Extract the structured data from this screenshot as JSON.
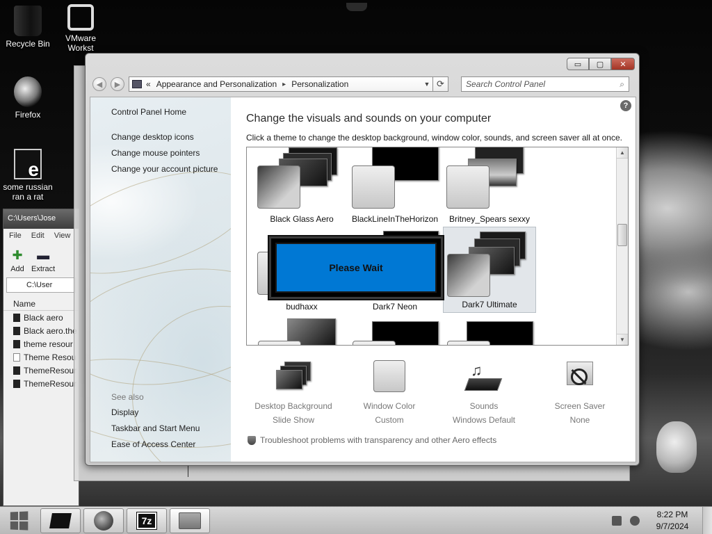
{
  "desktop": {
    "icons": [
      {
        "label": "Recycle Bin",
        "icon": "recycle-bin-icon"
      },
      {
        "label": "VMware Workst",
        "icon": "vmware-icon"
      },
      {
        "label": "Firefox",
        "icon": "firefox-icon"
      },
      {
        "label": "some russian ran a rat",
        "icon": "file-icon"
      }
    ]
  },
  "bg_window": {
    "title": "C:\\Users\\Jose",
    "menu": [
      "File",
      "Edit",
      "View"
    ],
    "tools": [
      {
        "label": "Add",
        "icon": "plus-icon"
      },
      {
        "label": "Extract",
        "icon": "minus-icon"
      }
    ],
    "address": "C:\\User",
    "column": "Name",
    "files": [
      "Black aero",
      "Black aero.the",
      "theme resour",
      "Theme Resou",
      "ThemeResour",
      "ThemeResour"
    ]
  },
  "window": {
    "caption": {
      "minimize": "▭",
      "maximize": "▢",
      "close": "✕"
    },
    "breadcrumb": {
      "root_chevron": "«",
      "level1": "Appearance and Personalization",
      "separator": "▸",
      "level2": "Personalization"
    },
    "search_placeholder": "Search Control Panel"
  },
  "left_pane": {
    "home": "Control Panel Home",
    "links": [
      "Change desktop icons",
      "Change mouse pointers",
      "Change your account picture"
    ],
    "see_also_title": "See also",
    "see_also": [
      "Display",
      "Taskbar and Start Menu",
      "Ease of Access Center"
    ]
  },
  "main": {
    "title": "Change the visuals and sounds on your computer",
    "subtitle": "Click a theme to change the desktop background, window color, sounds, and screen saver all at once.",
    "themes": [
      {
        "label": "Black Glass Aero",
        "selected": false
      },
      {
        "label": "BlackLineInTheHorizon",
        "selected": false
      },
      {
        "label": "Britney_Spears sexxy",
        "selected": false
      },
      {
        "label": "budhaxx",
        "selected": false
      },
      {
        "label": "Dark7 Neon",
        "selected": false
      },
      {
        "label": "Dark7 Ultimate",
        "selected": true
      }
    ],
    "overlay": "Please Wait",
    "overlay_color": "#0078d4",
    "tools": [
      {
        "title": "Desktop Background",
        "value": "Slide Show",
        "icon": "desktop-background-icon"
      },
      {
        "title": "Window Color",
        "value": "Custom",
        "icon": "window-color-icon"
      },
      {
        "title": "Sounds",
        "value": "Windows Default",
        "icon": "sounds-icon"
      },
      {
        "title": "Screen Saver",
        "value": "None",
        "icon": "screen-saver-icon"
      }
    ],
    "aero_link": "Troubleshoot problems with transparency and other Aero effects"
  },
  "taskbar": {
    "clock_time": "8:22 PM",
    "clock_date": "9/7/2024",
    "seven_zip_label": "7z"
  }
}
